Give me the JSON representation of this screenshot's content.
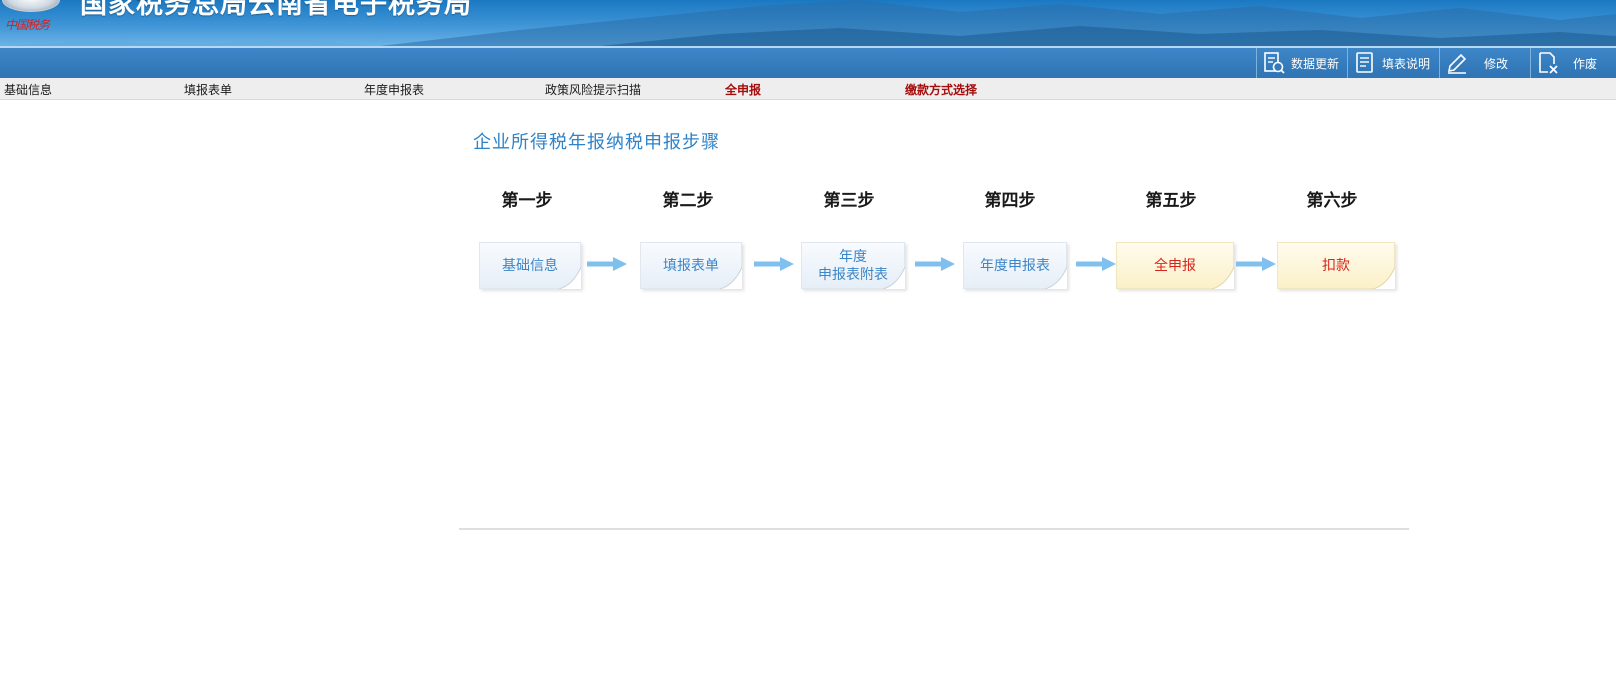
{
  "header": {
    "site_title": "国家税务总局云南省电子税务局",
    "logo_script": "中国税务"
  },
  "toolbar": {
    "items": [
      {
        "label": "数据更新",
        "icon": "data-refresh-icon"
      },
      {
        "label": "填表说明",
        "icon": "document-icon"
      },
      {
        "label": "修改",
        "icon": "pencil-icon"
      },
      {
        "label": "作废",
        "icon": "void-doc-icon"
      }
    ]
  },
  "nav": {
    "items": [
      {
        "label": "基础信息"
      },
      {
        "label": "填报表单"
      },
      {
        "label": "年度申报表"
      },
      {
        "label": "政策风险提示扫描"
      },
      {
        "label": "全申报"
      },
      {
        "label": "缴款方式选择"
      }
    ]
  },
  "steps": {
    "title": "企业所得税年报纳税申报步骤",
    "items": [
      {
        "head": "第一步",
        "label": "基础信息"
      },
      {
        "head": "第二步",
        "label": "填报表单"
      },
      {
        "head": "第三步",
        "label_line1": "年度",
        "label_line2": "申报表附表"
      },
      {
        "head": "第四步",
        "label": "年度申报表"
      },
      {
        "head": "第五步",
        "label": "全申报"
      },
      {
        "head": "第六步",
        "label": "扣款"
      }
    ]
  },
  "colors": {
    "banner": "#2f7fc4",
    "toolbar": "#3479bb",
    "accent_blue": "#3b86c8",
    "accent_red": "#a50d0d",
    "step_red": "#d9241c"
  }
}
